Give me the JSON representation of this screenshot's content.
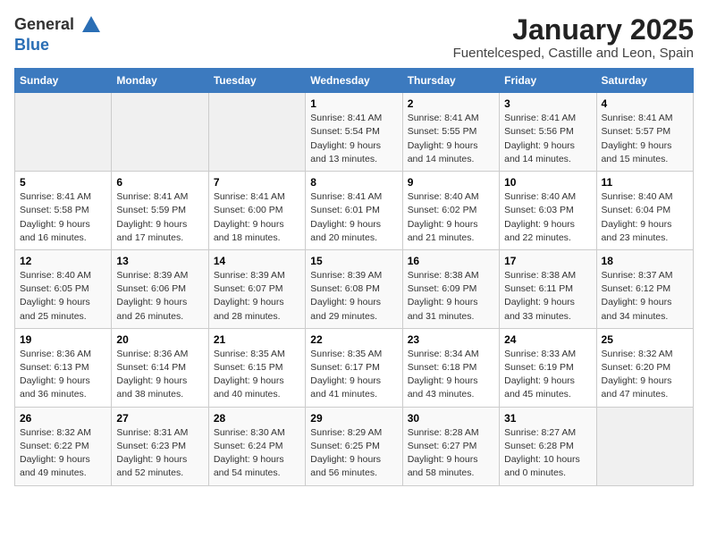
{
  "header": {
    "logo_line1": "General",
    "logo_line2": "Blue",
    "month": "January 2025",
    "location": "Fuentelcesped, Castille and Leon, Spain"
  },
  "weekdays": [
    "Sunday",
    "Monday",
    "Tuesday",
    "Wednesday",
    "Thursday",
    "Friday",
    "Saturday"
  ],
  "weeks": [
    [
      {
        "day": "",
        "info": ""
      },
      {
        "day": "",
        "info": ""
      },
      {
        "day": "",
        "info": ""
      },
      {
        "day": "1",
        "info": "Sunrise: 8:41 AM\nSunset: 5:54 PM\nDaylight: 9 hours and 13 minutes."
      },
      {
        "day": "2",
        "info": "Sunrise: 8:41 AM\nSunset: 5:55 PM\nDaylight: 9 hours and 14 minutes."
      },
      {
        "day": "3",
        "info": "Sunrise: 8:41 AM\nSunset: 5:56 PM\nDaylight: 9 hours and 14 minutes."
      },
      {
        "day": "4",
        "info": "Sunrise: 8:41 AM\nSunset: 5:57 PM\nDaylight: 9 hours and 15 minutes."
      }
    ],
    [
      {
        "day": "5",
        "info": "Sunrise: 8:41 AM\nSunset: 5:58 PM\nDaylight: 9 hours and 16 minutes."
      },
      {
        "day": "6",
        "info": "Sunrise: 8:41 AM\nSunset: 5:59 PM\nDaylight: 9 hours and 17 minutes."
      },
      {
        "day": "7",
        "info": "Sunrise: 8:41 AM\nSunset: 6:00 PM\nDaylight: 9 hours and 18 minutes."
      },
      {
        "day": "8",
        "info": "Sunrise: 8:41 AM\nSunset: 6:01 PM\nDaylight: 9 hours and 20 minutes."
      },
      {
        "day": "9",
        "info": "Sunrise: 8:40 AM\nSunset: 6:02 PM\nDaylight: 9 hours and 21 minutes."
      },
      {
        "day": "10",
        "info": "Sunrise: 8:40 AM\nSunset: 6:03 PM\nDaylight: 9 hours and 22 minutes."
      },
      {
        "day": "11",
        "info": "Sunrise: 8:40 AM\nSunset: 6:04 PM\nDaylight: 9 hours and 23 minutes."
      }
    ],
    [
      {
        "day": "12",
        "info": "Sunrise: 8:40 AM\nSunset: 6:05 PM\nDaylight: 9 hours and 25 minutes."
      },
      {
        "day": "13",
        "info": "Sunrise: 8:39 AM\nSunset: 6:06 PM\nDaylight: 9 hours and 26 minutes."
      },
      {
        "day": "14",
        "info": "Sunrise: 8:39 AM\nSunset: 6:07 PM\nDaylight: 9 hours and 28 minutes."
      },
      {
        "day": "15",
        "info": "Sunrise: 8:39 AM\nSunset: 6:08 PM\nDaylight: 9 hours and 29 minutes."
      },
      {
        "day": "16",
        "info": "Sunrise: 8:38 AM\nSunset: 6:09 PM\nDaylight: 9 hours and 31 minutes."
      },
      {
        "day": "17",
        "info": "Sunrise: 8:38 AM\nSunset: 6:11 PM\nDaylight: 9 hours and 33 minutes."
      },
      {
        "day": "18",
        "info": "Sunrise: 8:37 AM\nSunset: 6:12 PM\nDaylight: 9 hours and 34 minutes."
      }
    ],
    [
      {
        "day": "19",
        "info": "Sunrise: 8:36 AM\nSunset: 6:13 PM\nDaylight: 9 hours and 36 minutes."
      },
      {
        "day": "20",
        "info": "Sunrise: 8:36 AM\nSunset: 6:14 PM\nDaylight: 9 hours and 38 minutes."
      },
      {
        "day": "21",
        "info": "Sunrise: 8:35 AM\nSunset: 6:15 PM\nDaylight: 9 hours and 40 minutes."
      },
      {
        "day": "22",
        "info": "Sunrise: 8:35 AM\nSunset: 6:17 PM\nDaylight: 9 hours and 41 minutes."
      },
      {
        "day": "23",
        "info": "Sunrise: 8:34 AM\nSunset: 6:18 PM\nDaylight: 9 hours and 43 minutes."
      },
      {
        "day": "24",
        "info": "Sunrise: 8:33 AM\nSunset: 6:19 PM\nDaylight: 9 hours and 45 minutes."
      },
      {
        "day": "25",
        "info": "Sunrise: 8:32 AM\nSunset: 6:20 PM\nDaylight: 9 hours and 47 minutes."
      }
    ],
    [
      {
        "day": "26",
        "info": "Sunrise: 8:32 AM\nSunset: 6:22 PM\nDaylight: 9 hours and 49 minutes."
      },
      {
        "day": "27",
        "info": "Sunrise: 8:31 AM\nSunset: 6:23 PM\nDaylight: 9 hours and 52 minutes."
      },
      {
        "day": "28",
        "info": "Sunrise: 8:30 AM\nSunset: 6:24 PM\nDaylight: 9 hours and 54 minutes."
      },
      {
        "day": "29",
        "info": "Sunrise: 8:29 AM\nSunset: 6:25 PM\nDaylight: 9 hours and 56 minutes."
      },
      {
        "day": "30",
        "info": "Sunrise: 8:28 AM\nSunset: 6:27 PM\nDaylight: 9 hours and 58 minutes."
      },
      {
        "day": "31",
        "info": "Sunrise: 8:27 AM\nSunset: 6:28 PM\nDaylight: 10 hours and 0 minutes."
      },
      {
        "day": "",
        "info": ""
      }
    ]
  ]
}
